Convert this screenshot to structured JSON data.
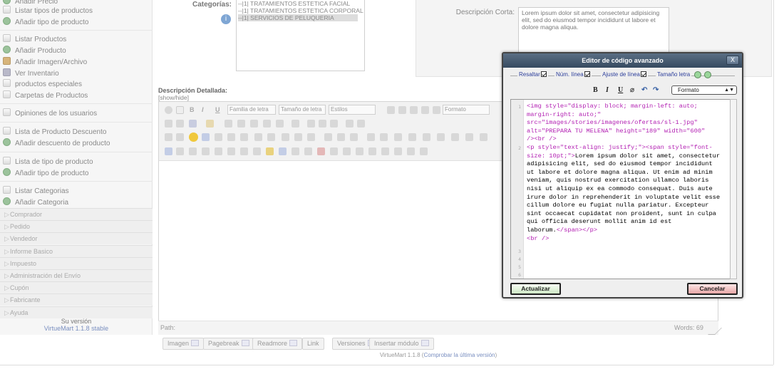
{
  "sidebar": {
    "items": [
      {
        "label": "Añadir Precio",
        "icon": "add-icon"
      },
      {
        "label": "Listar tipos de productos",
        "icon": "doc-icon"
      },
      {
        "label": "Añadir tipo de producto",
        "icon": "add-icon"
      },
      {
        "label": "Listar Productos",
        "icon": "doc-icon"
      },
      {
        "label": "Añadir Producto",
        "icon": "add-icon"
      },
      {
        "label": "Añadir Imagen/Archivo",
        "icon": "image-icon"
      },
      {
        "label": "Ver Inventario",
        "icon": "inventory-icon"
      },
      {
        "label": "productos especiales",
        "icon": "doc-icon"
      },
      {
        "label": "Carpetas de Productos",
        "icon": "doc-icon"
      },
      {
        "label": "Opiniones de los usuarios",
        "icon": "doc-icon"
      },
      {
        "label": "Lista de Producto Descuento",
        "icon": "doc-icon"
      },
      {
        "label": "Añadir descuento de producto",
        "icon": "add-icon"
      },
      {
        "label": "Lista de tipo de producto",
        "icon": "doc-icon"
      },
      {
        "label": "Añadir tipo de producto",
        "icon": "add-icon"
      },
      {
        "label": "Listar Categorias",
        "icon": "doc-icon"
      },
      {
        "label": "Añadir Categoria",
        "icon": "add-icon"
      }
    ],
    "sections": [
      "Comprador",
      "Pedido",
      "Vendedor",
      "Informe Basico",
      "Impuesto",
      "Administración del Envío",
      "Cupón",
      "Fabricante",
      "Ayuda"
    ],
    "version_title": "Su versión",
    "version_link": "VirtueMart 1.1.8 stable"
  },
  "form": {
    "categories_label": "Categorías:",
    "categories": [
      "--|1| TRATAMIENTOS ESTETICA FACIAL",
      "--|1| TRATAMIENTOS ESTETICA CORPORAL",
      "--|1| SERVICIOS DE PELUQUERIA"
    ],
    "short_desc_label": "Descripción Corta:",
    "short_desc_value": "Lorem ipsum dolor sit amet, consectetur adipisicing elit, sed do eiusmod tempor incididunt ut labore et dolore magna aliqua."
  },
  "editor": {
    "title": "Descripción Detallada:",
    "show_hide": "[show/hide]",
    "font_family": "Familia de letra",
    "font_size": "Tamaño de letra",
    "styles": "Estilos",
    "format": "Formato",
    "path_label": "Path:",
    "words": "Words: 69"
  },
  "plugins": [
    {
      "label": "Imagen"
    },
    {
      "label": "Pagebreak"
    },
    {
      "label": "Readmore"
    },
    {
      "label": "Link"
    },
    {
      "label": "Versiones"
    },
    {
      "label": "Insertar módulo"
    }
  ],
  "footer": {
    "version": "VirtueMart 1.1.8 (",
    "check_link": "Comprobar la última versión",
    "close_paren": ")"
  },
  "modal": {
    "title": "Editor de código avanzado",
    "close": "X",
    "opt_wrap": "Resaltar",
    "opt_lines": "Núm. línea",
    "opt_adjust": "Ajuste de línea",
    "opt_size": "Tamaño letra",
    "bold": "B",
    "italic": "I",
    "underline": "U",
    "format_select": "Formato",
    "line_numbers": [
      "1",
      "2",
      "3",
      "4",
      "5",
      "6"
    ],
    "update": "Actualizar",
    "cancel": "Cancelar"
  }
}
